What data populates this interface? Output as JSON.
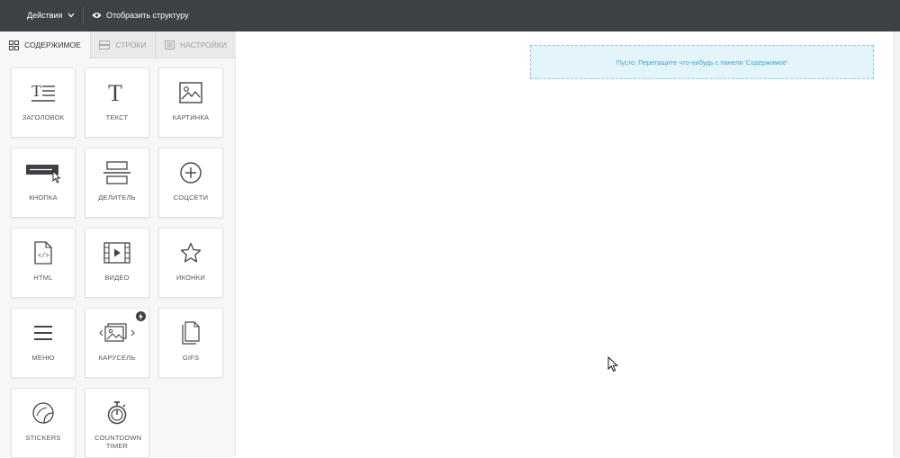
{
  "topbar": {
    "actions_label": "Действия",
    "structure_label": "Отобразить структуру"
  },
  "sidebar": {
    "tabs": [
      {
        "label": "СОДЕРЖИМОЕ",
        "icon": "grid-icon",
        "active": true
      },
      {
        "label": "СТРОКИ",
        "icon": "rows-icon",
        "active": false
      },
      {
        "label": "НАСТРОЙКИ",
        "icon": "settings-panel-icon",
        "active": false
      }
    ],
    "blocks": [
      {
        "label": "ЗАГОЛОВОК",
        "icon": "heading-icon"
      },
      {
        "label": "ТЕКСТ",
        "icon": "text-icon"
      },
      {
        "label": "КАРТИНКА",
        "icon": "image-icon"
      },
      {
        "label": "КНОПКА",
        "icon": "button-icon"
      },
      {
        "label": "ДЕЛИТЕЛЬ",
        "icon": "divider-icon"
      },
      {
        "label": "СОЦСЕТИ",
        "icon": "social-plus-icon"
      },
      {
        "label": "HTML",
        "icon": "html-file-icon"
      },
      {
        "label": "ВИДЕО",
        "icon": "video-icon"
      },
      {
        "label": "ИКОНКИ",
        "icon": "star-icon"
      },
      {
        "label": "МЕНЮ",
        "icon": "menu-icon"
      },
      {
        "label": "КАРУСЕЛЬ",
        "icon": "carousel-icon",
        "badge": "lightning-badge-icon"
      },
      {
        "label": "GIFS",
        "icon": "gif-file-icon"
      },
      {
        "label": "STICKERS",
        "icon": "sticker-icon"
      },
      {
        "label": "COUNTDOWN TIMER",
        "icon": "timer-icon"
      }
    ]
  },
  "canvas": {
    "dropzone_text": "Пусто. Перетащите что-нибудь с панели 'Содержимое'"
  },
  "colors": {
    "topbar": "#3d4044",
    "dropzone_bg": "#e3f4fb",
    "dropzone_text": "#4aa3c9"
  }
}
